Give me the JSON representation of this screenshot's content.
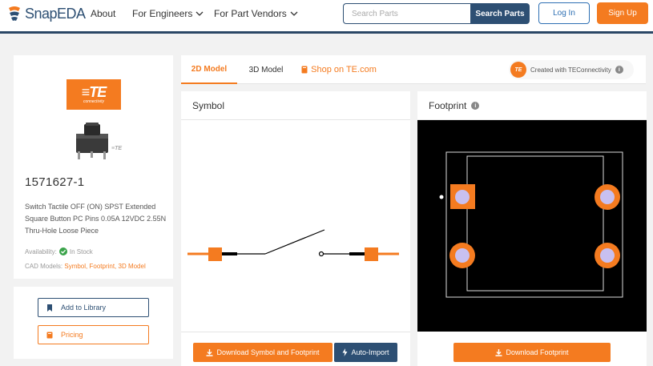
{
  "header": {
    "logo_text": "SnapEDA",
    "nav": [
      {
        "label": "About",
        "has_chevron": false
      },
      {
        "label": "For Engineers",
        "has_chevron": true
      },
      {
        "label": "For Part Vendors",
        "has_chevron": true
      }
    ],
    "search_placeholder": "Search Parts",
    "search_button": "Search Parts",
    "login": "Log In",
    "signup": "Sign Up"
  },
  "part": {
    "brand_logo_text": "TE",
    "brand_logo_sub": "connectivity",
    "part_number": "1571627-1",
    "description": "Switch Tactile OFF (ON) SPST Extended Square Button PC Pins 0.05A 12VDC 2.55N Thru-Hole Loose Piece",
    "availability_label": "Availability:",
    "availability_value": "In Stock",
    "cad_models_label": "CAD Models:",
    "cad_models_links": "Symbol, Footprint, 3D Model"
  },
  "actions": {
    "add_to_library": "Add to Library",
    "pricing": "Pricing"
  },
  "tabs": {
    "model_2d": "2D Model",
    "model_3d": "3D Model",
    "shop": "Shop on TE.com",
    "created_with": "Created with TEConnectivity",
    "created_badge": "TE"
  },
  "symbol": {
    "title": "Symbol",
    "download": "Download Symbol and Footprint",
    "auto_import": "Auto-Import"
  },
  "footprint": {
    "title": "Footprint",
    "download": "Download Footprint"
  },
  "colors": {
    "brand_orange": "#f47b20",
    "brand_navy": "#2d4f73",
    "pad_fill": "#c8c0f0"
  },
  "icons": [
    "chevron-down-icon",
    "bookmark-icon",
    "tag-icon",
    "download-icon",
    "bolt-icon",
    "info-icon",
    "check-circle-icon",
    "shop-icon"
  ]
}
